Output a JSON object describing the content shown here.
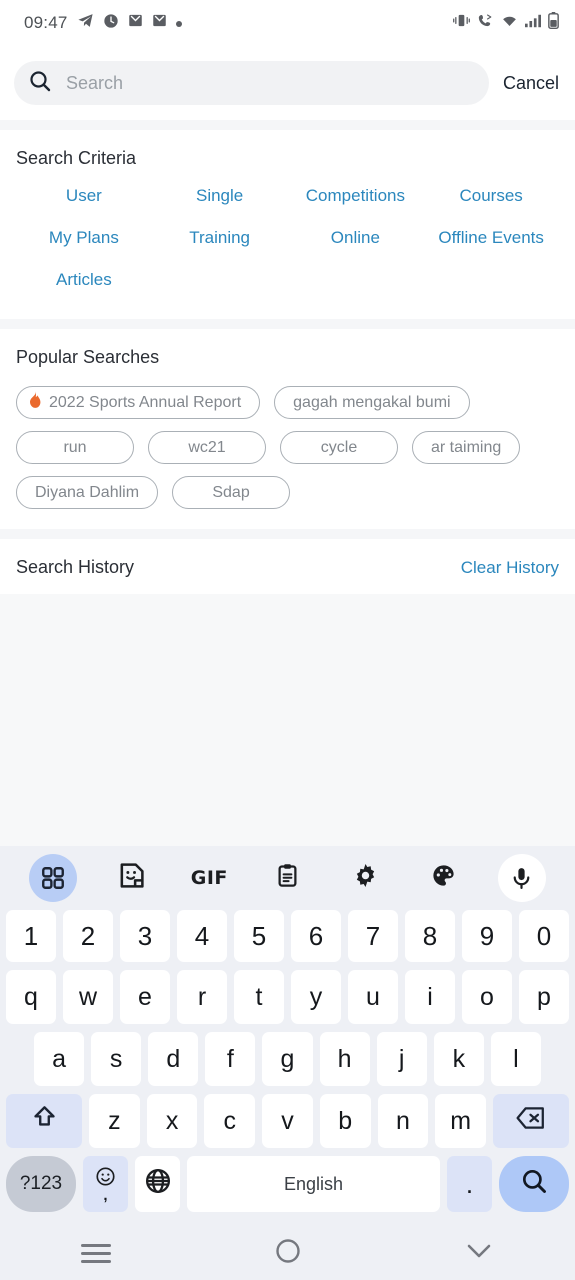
{
  "statusbar": {
    "time": "09:47",
    "left_icons": [
      "telegram-icon",
      "clock-icon",
      "mail-icon",
      "mail-icon",
      "dot-icon"
    ],
    "right_icons": [
      "vibrate-icon",
      "call-forward-icon",
      "wifi-icon",
      "signal-icon",
      "battery-icon"
    ]
  },
  "search": {
    "placeholder": "Search",
    "value": "",
    "cancel_label": "Cancel"
  },
  "criteria": {
    "title": "Search Criteria",
    "items": [
      {
        "label": "User"
      },
      {
        "label": "Single"
      },
      {
        "label": "Competitions"
      },
      {
        "label": "Courses"
      },
      {
        "label": "My Plans"
      },
      {
        "label": "Training"
      },
      {
        "label": "Online"
      },
      {
        "label": "Offline Events"
      },
      {
        "label": "Articles"
      }
    ]
  },
  "popular": {
    "title": "Popular Searches",
    "chips": [
      {
        "label": "2022 Sports Annual Report",
        "hot": true
      },
      {
        "label": "gagah mengakal bumi",
        "hot": false
      },
      {
        "label": "run",
        "hot": false
      },
      {
        "label": "wc21",
        "hot": false
      },
      {
        "label": "cycle",
        "hot": false
      },
      {
        "label": "ar taiming",
        "hot": false
      },
      {
        "label": "Diyana Dahlim",
        "hot": false
      },
      {
        "label": "Sdap",
        "hot": false
      }
    ]
  },
  "history": {
    "title": "Search History",
    "clear_label": "Clear History",
    "items": []
  },
  "keyboard": {
    "toolbar": [
      {
        "icon": "apps-grid-icon",
        "active": true
      },
      {
        "icon": "sticker-icon",
        "active": false
      },
      {
        "icon": "gif-icon",
        "label": "GIF",
        "active": false
      },
      {
        "icon": "clipboard-icon",
        "active": false
      },
      {
        "icon": "gear-icon",
        "active": false
      },
      {
        "icon": "palette-icon",
        "active": false
      },
      {
        "icon": "microphone-icon",
        "active": false
      }
    ],
    "row_numbers": [
      "1",
      "2",
      "3",
      "4",
      "5",
      "6",
      "7",
      "8",
      "9",
      "0"
    ],
    "row_top": [
      "q",
      "w",
      "e",
      "r",
      "t",
      "y",
      "u",
      "i",
      "o",
      "p"
    ],
    "row_home": [
      "a",
      "s",
      "d",
      "f",
      "g",
      "h",
      "j",
      "k",
      "l"
    ],
    "row_bottom": [
      "z",
      "x",
      "c",
      "v",
      "b",
      "n",
      "m"
    ],
    "shift_label": "shift-icon",
    "backspace_label": "backspace-icon",
    "symbols_label": "?123",
    "emoji_label": "emoji-icon",
    "comma_label": ",",
    "globe_label": "globe-icon",
    "space_label": "English",
    "period_label": ".",
    "enter_label": "search-icon"
  },
  "navbar": {
    "recents_label": "recents-icon",
    "home_label": "home-icon",
    "back_label": "chevron-down-icon"
  },
  "colors": {
    "link_blue": "#2b87bd",
    "flame_orange": "#ea6a2e",
    "key_accent": "#aec8f7",
    "chip_border": "#aab0b6",
    "search_pill": "#f1f2f4"
  }
}
